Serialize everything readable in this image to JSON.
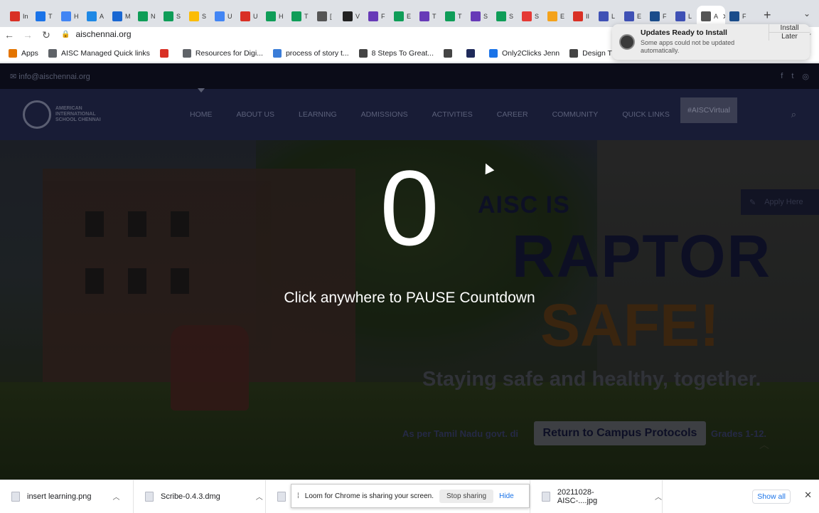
{
  "browser": {
    "tabs": [
      {
        "label": "In",
        "color": "#d93025"
      },
      {
        "label": "T",
        "color": "#1a73e8"
      },
      {
        "label": "H",
        "color": "#4285f4"
      },
      {
        "label": "A",
        "color": "#1e88e5"
      },
      {
        "label": "M",
        "color": "#1967d2"
      },
      {
        "label": "N",
        "color": "#0f9d58"
      },
      {
        "label": "S",
        "color": "#0f9d58"
      },
      {
        "label": "S",
        "color": "#fbbc04"
      },
      {
        "label": "U",
        "color": "#4285f4"
      },
      {
        "label": "U",
        "color": "#d93025"
      },
      {
        "label": "H",
        "color": "#0f9d58"
      },
      {
        "label": "T",
        "color": "#0f9d58"
      },
      {
        "label": "[",
        "color": "#555555"
      },
      {
        "label": "V",
        "color": "#222222"
      },
      {
        "label": "F",
        "color": "#673ab7"
      },
      {
        "label": "E",
        "color": "#0f9d58"
      },
      {
        "label": "T",
        "color": "#673ab7"
      },
      {
        "label": "T",
        "color": "#0f9d58"
      },
      {
        "label": "S",
        "color": "#673ab7"
      },
      {
        "label": "S",
        "color": "#0f9d58"
      },
      {
        "label": "S",
        "color": "#e53935"
      },
      {
        "label": "E",
        "color": "#f4a21b"
      },
      {
        "label": "II",
        "color": "#d93025"
      },
      {
        "label": "L",
        "color": "#3f51b5"
      },
      {
        "label": "E",
        "color": "#3f51b5"
      },
      {
        "label": "F",
        "color": "#1a4c8b"
      },
      {
        "label": "L",
        "color": "#3f51b5"
      },
      {
        "label": "A",
        "color": "#555555",
        "active": true
      },
      {
        "label": "F",
        "color": "#1a4c8b"
      }
    ],
    "url": "aischennai.org",
    "bookmarks": [
      {
        "label": "Apps",
        "color": "#e37400"
      },
      {
        "label": "AISC Managed Quick links",
        "color": "#5f6368"
      },
      {
        "label": "",
        "color": "#d93025"
      },
      {
        "label": "Resources for Digi...",
        "color": "#5f6368"
      },
      {
        "label": "process of story t...",
        "color": "#3b7dd8"
      },
      {
        "label": "8 Steps To Great...",
        "color": "#444444"
      },
      {
        "label": "",
        "color": "#444444"
      },
      {
        "label": "",
        "color": "#1f2a5a"
      },
      {
        "label": "Only2Clicks Jenn",
        "color": "#1a73e8"
      },
      {
        "label": "Design Thinking F",
        "color": "#444444"
      }
    ]
  },
  "notification": {
    "title": "Updates Ready to Install",
    "text": "Some apps could not be updated automatically.",
    "install": "Install",
    "later": "Later"
  },
  "site": {
    "email": "info@aischennai.org",
    "logo_text": "AMERICAN INTERNATIONAL SCHOOL CHENNAI",
    "nav": [
      "HOME",
      "ABOUT US",
      "LEARNING",
      "ADMISSIONS",
      "ACTIVITIES",
      "CAREER",
      "COMMUNITY",
      "QUICK LINKS"
    ],
    "virtual": "#AISCVirtual",
    "hero": {
      "countdown": "0",
      "click_text": "Click anywhere to PAUSE Countdown",
      "aisc_is": "AISC IS",
      "raptor": "RAPTOR",
      "safe": "SAFE!",
      "staying": "Staying safe and healthy, together.",
      "per_tn": "As per Tamil Nadu govt. di",
      "grades": "Grades 1-12.",
      "protocols": "Return to Campus Protocols",
      "apply": "Apply Here"
    }
  },
  "downloads": {
    "items": [
      "insert learning.png",
      "Scribe-0.4.3.dmg",
      "",
      "20211028-AISC-....jpg"
    ],
    "show_all": "Show all"
  },
  "loom": {
    "text": "Loom for Chrome is sharing your screen.",
    "stop": "Stop sharing",
    "hide": "Hide"
  }
}
